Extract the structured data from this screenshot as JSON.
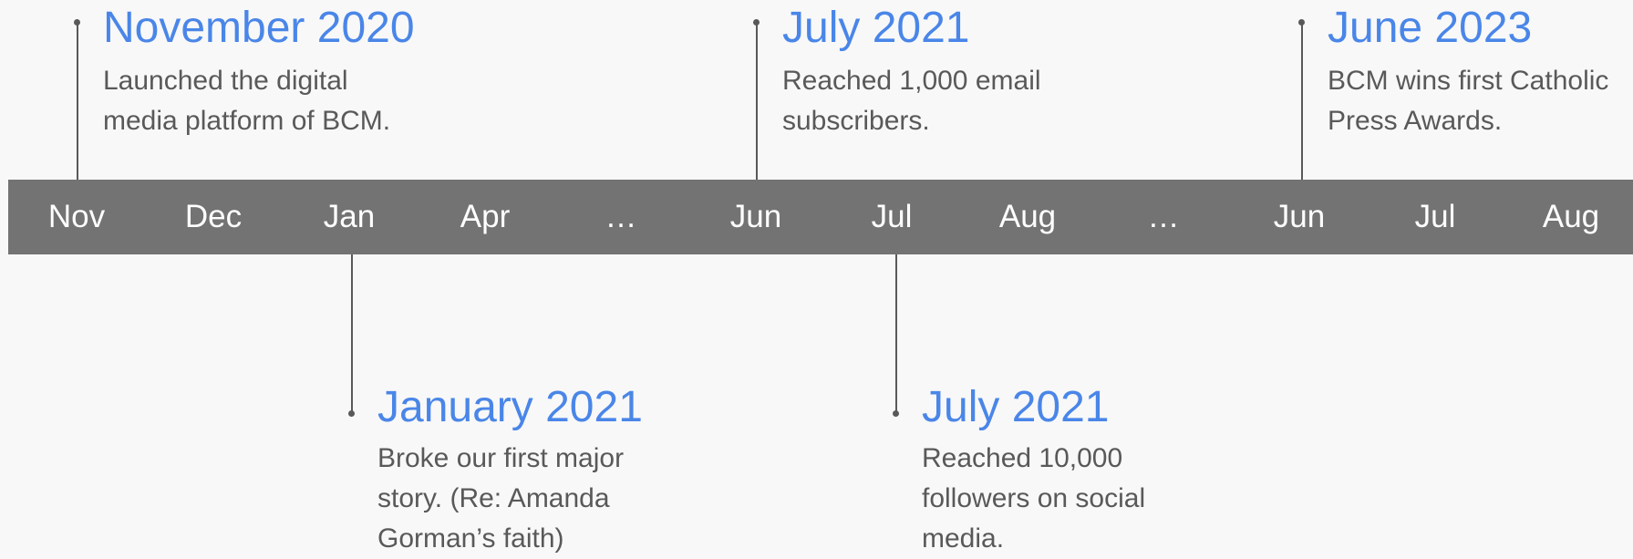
{
  "colors": {
    "background": "#f8f8f8",
    "timeline_bar": "#737373",
    "month_text": "#ffffff",
    "event_title": "#4a86e8",
    "event_text": "#595959",
    "connector": "#595959"
  },
  "timeline": {
    "months": [
      "Nov",
      "Dec",
      "Jan",
      "Apr",
      "…",
      "Jun",
      "Jul",
      "Aug",
      "…",
      "Jun",
      "Jul",
      "Aug"
    ]
  },
  "events": [
    {
      "title": "November 2020",
      "description": "Launched the digital media platform of BCM."
    },
    {
      "title": "July 2021",
      "description": "Reached 1,000 email subscribers."
    },
    {
      "title": "June 2023",
      "description": "BCM wins first Catholic Press Awards."
    },
    {
      "title": "January 2021",
      "description": "Broke our first major story. (Re: Amanda Gorman’s faith)"
    },
    {
      "title": "July 2021",
      "description": "Reached 10,000 followers on social media."
    }
  ]
}
